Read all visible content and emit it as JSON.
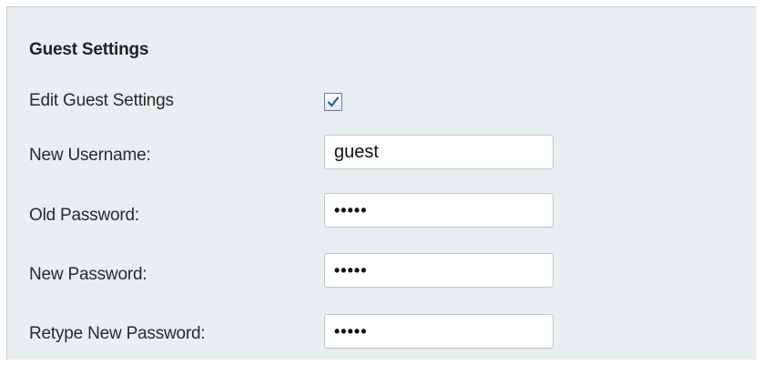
{
  "section": {
    "title": "Guest Settings"
  },
  "rows": {
    "edit_guest_settings": {
      "label": "Edit Guest Settings",
      "checked": true
    },
    "new_username": {
      "label": "New Username:",
      "value": "guest"
    },
    "old_password": {
      "label": "Old Password:",
      "value": "•••••"
    },
    "new_password": {
      "label": "New Password:",
      "value": "•••••"
    },
    "retype_new_password": {
      "label": "Retype New Password:",
      "value": "•••••"
    }
  },
  "colors": {
    "panel_bg": "#e9eef0",
    "checkmark": "#2f59a8"
  },
  "icons": {
    "checkbox_checked": "check-icon"
  }
}
